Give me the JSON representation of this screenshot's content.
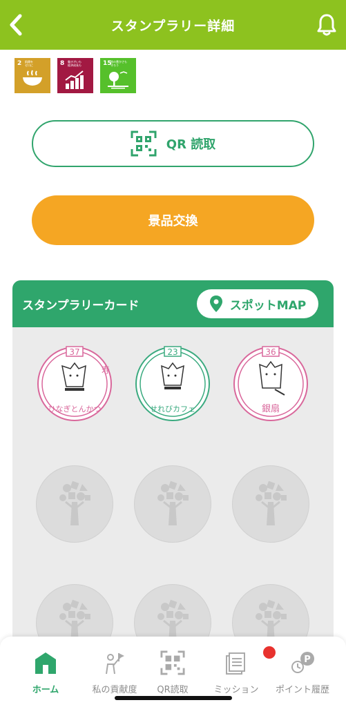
{
  "header": {
    "title": "スタンプラリー詳細",
    "bg_color": "#8dc21f",
    "back_icon": "chevron-left-icon",
    "bell_icon": "bell-icon"
  },
  "sdgs": [
    {
      "num": "2",
      "text": "飢餓を\nゼロに",
      "color": "#d3a029",
      "icon": "bowl-icon"
    },
    {
      "num": "8",
      "text": "働きがいも\n経済成長も",
      "color": "#a21942",
      "icon": "growth-chart-icon"
    },
    {
      "num": "15",
      "text": "陸の豊かさも\n守ろう",
      "color": "#56c02b",
      "icon": "tree-bird-icon"
    }
  ],
  "qr_button": {
    "label": "QR 読取",
    "icon": "qr-code-icon"
  },
  "prize_button": {
    "label": "景品交換"
  },
  "card": {
    "title": "スタンプラリーカード",
    "spot_label": "スポットMAP",
    "spot_icon": "map-pin-icon"
  },
  "stamps": [
    {
      "num": "37",
      "text": "ひなぎとんかつ",
      "side": "寿",
      "color": "#d9679b",
      "collected": true
    },
    {
      "num": "23",
      "text": "せれびカフェ",
      "side": "",
      "color": "#3aaa7f",
      "collected": true
    },
    {
      "num": "36",
      "text": "銀扇",
      "side": "",
      "color": "#d9679b",
      "collected": true
    },
    {
      "collected": false
    },
    {
      "collected": false
    },
    {
      "collected": false
    },
    {
      "collected": false
    },
    {
      "collected": false
    },
    {
      "collected": false
    }
  ],
  "tabs": [
    {
      "label": "ホーム",
      "icon": "home-icon",
      "active": true
    },
    {
      "label": "私の貢献度",
      "icon": "contribution-icon",
      "active": false
    },
    {
      "label": "QR読取",
      "icon": "qr-code-icon",
      "active": false
    },
    {
      "label": "ミッション",
      "icon": "mission-icon",
      "active": false
    },
    {
      "label": "ポイント履歴",
      "icon": "point-history-icon",
      "active": false
    }
  ]
}
